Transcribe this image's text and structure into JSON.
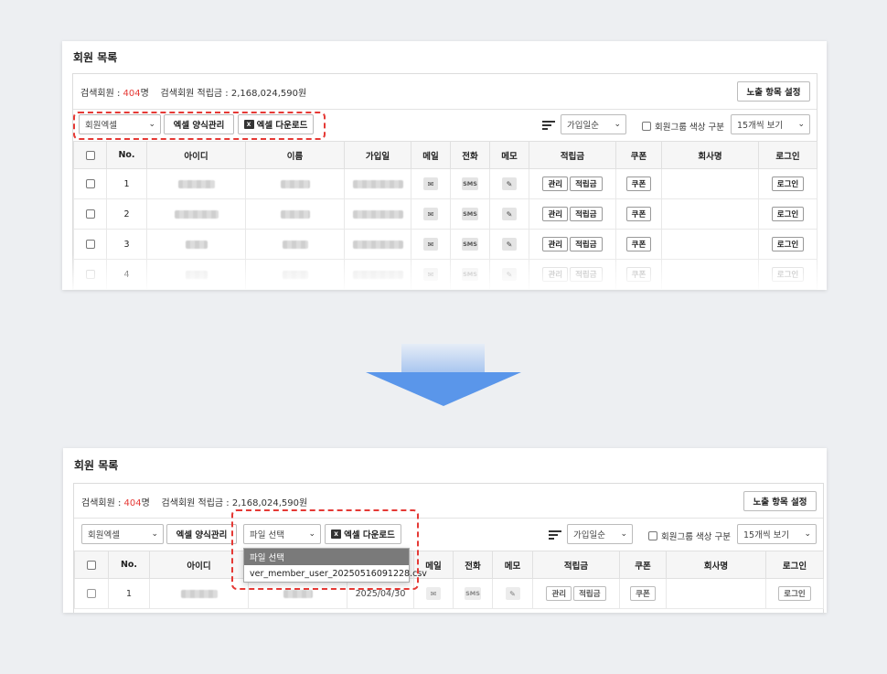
{
  "panel_title": "회원 목록",
  "summary": {
    "search_label": "검색회원 : ",
    "search_count": "404",
    "search_unit": "명",
    "points_label": "검색회원 적립금 : ",
    "points_value": "2,168,024,590",
    "points_unit": "원"
  },
  "toolbar": {
    "column_settings": "노출 항목 설정",
    "excel_select": "회원엑셀",
    "excel_form_manage": "엑셀 양식관리",
    "excel_download": "엑셀 다운로드",
    "file_select": "파일 선택",
    "sort_select": "가입일순",
    "group_color_label": "회원그룹 색상 구분",
    "page_size": "15개씩 보기"
  },
  "file_dropdown": {
    "options": [
      "파일 선택",
      "ver_member_user_20250516091228.csv"
    ]
  },
  "table": {
    "headers": [
      "",
      "No.",
      "아이디",
      "이름",
      "가입일",
      "메일",
      "전화",
      "메모",
      "적립금",
      "쿠폰",
      "회사명",
      "로그인"
    ],
    "rows": [
      {
        "no": "1"
      },
      {
        "no": "2"
      },
      {
        "no": "3"
      },
      {
        "no": "4"
      }
    ],
    "bottom_row": {
      "no": "1",
      "date": "2025/04/30"
    },
    "btn_manage": "관리",
    "btn_points": "적립금",
    "btn_coupon": "쿠폰",
    "btn_login": "로그인",
    "sms": "SMS"
  },
  "colors": {
    "highlight": "#e53935",
    "arrow": "#5a96ea",
    "background": "#edeff2"
  },
  "icons": [
    "mail-icon",
    "pencil-icon",
    "sort-icon",
    "excel-icon",
    "chevron-down-icon"
  ]
}
